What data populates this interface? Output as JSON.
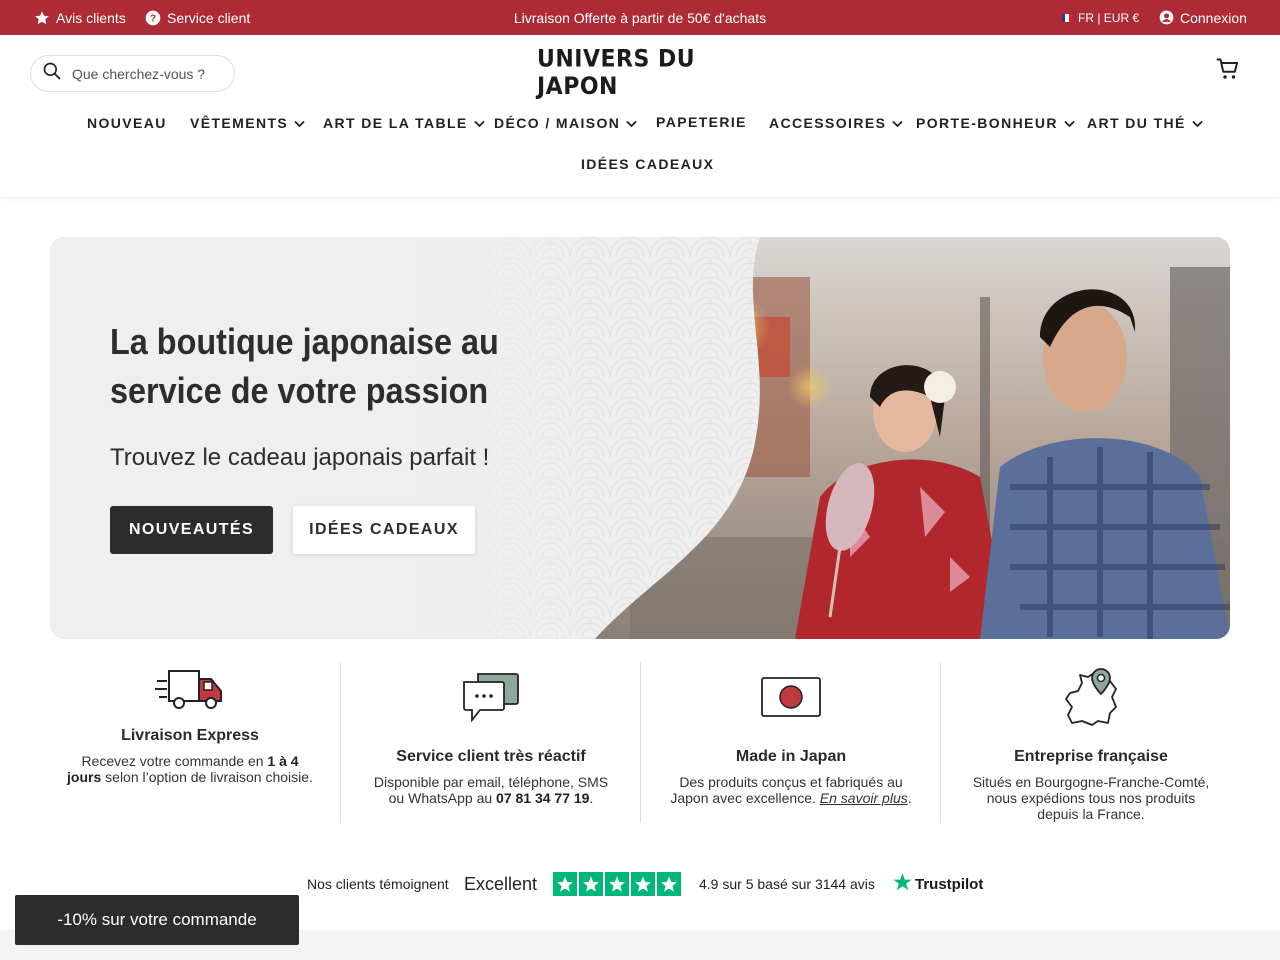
{
  "topbar": {
    "reviews_label": "Avis clients",
    "support_label": "Service client",
    "announcement": "Livraison Offerte à partir de 50€ d'achats",
    "lang_currency": "FR | EUR €",
    "login_label": "Connexion"
  },
  "header": {
    "search_placeholder": "Que cherchez-vous ?",
    "logo_text": "UNIVERS DU JAPON"
  },
  "nav": {
    "items": [
      {
        "label": "NOUVEAU"
      },
      {
        "label": "VÊTEMENTS"
      },
      {
        "label": "ART DE LA TABLE"
      },
      {
        "label": "DÉCO / MAISON"
      },
      {
        "label": "PAPETERIE"
      },
      {
        "label": "ACCESSOIRES"
      },
      {
        "label": "PORTE-BONHEUR"
      },
      {
        "label": "ART DU THÉ"
      },
      {
        "label": "IDÉES CADEAUX"
      }
    ]
  },
  "hero": {
    "title": "La boutique japonaise au service de votre passion",
    "subtitle": "Trouvez le cadeau japonais parfait !",
    "primary_button": "NOUVEAUTÉS",
    "secondary_button": "IDÉES CADEAUX"
  },
  "features": [
    {
      "title": "Livraison Express",
      "text_before": "Recevez votre commande en ",
      "text_bold": "1 à 4 jours",
      "text_after": " selon l’option de livraison choisie."
    },
    {
      "title": "Service client très réactif",
      "text_before": "Disponible par email, téléphone, SMS ou WhatsApp au ",
      "text_bold": "07 81 34 77 19",
      "text_after": "."
    },
    {
      "title": "Made in Japan",
      "text_before": "Des produits conçus et fabriqués au Japon avec excellence. ",
      "text_link": "En savoir plus",
      "text_after": "."
    },
    {
      "title": "Entreprise française",
      "text": "Situés en Bourgogne-Franche-Comté, nous expédions tous nos produits depuis la France."
    }
  ],
  "trust": {
    "intro": "Nos clients témoignent",
    "rating_word": "Excellent",
    "rating_text": "4.9 sur 5 basé sur 3144 avis",
    "brand": "Trustpilot",
    "stars": 5
  },
  "promo": {
    "label": "-10% sur votre commande"
  },
  "colors": {
    "topbar_bg": "#ad2b37",
    "dark_button": "#2c2c2c",
    "trustpilot_green": "#00b67a"
  }
}
